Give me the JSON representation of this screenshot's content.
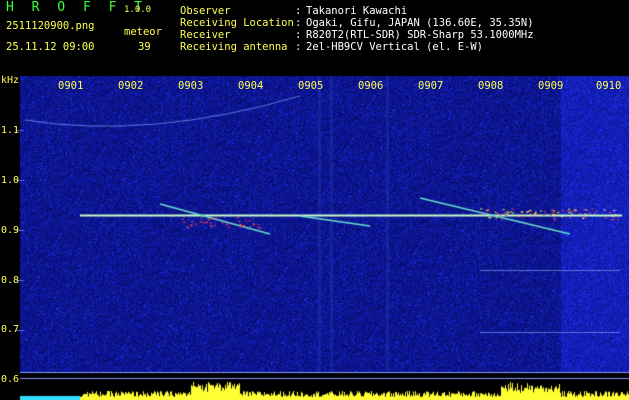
{
  "app": {
    "name": "H R O F F T",
    "version": "1.0.0"
  },
  "file": {
    "name": "2511120900.png",
    "datetime": "25.11.12 09:00"
  },
  "meteor": {
    "label": "meteor",
    "count": "39"
  },
  "info": [
    {
      "label": "Observer",
      "value": "Takanori Kawachi"
    },
    {
      "label": "Receiving Location",
      "value": "Ogaki, Gifu, JAPAN (136.60E, 35.35N)"
    },
    {
      "label": "Receiver",
      "value": "R820T2(RTL-SDR) SDR-Sharp 53.1000MHz"
    },
    {
      "label": "Receiving antenna",
      "value": "2el-HB9CV Vertical (el. E-W)"
    }
  ],
  "separator": ":",
  "axis": {
    "y_unit": "kHz",
    "y_ticks": [
      "1.1",
      "1.0",
      "0.9",
      "0.8",
      "0.7",
      "0.6"
    ],
    "time_ticks": [
      "0901",
      "0902",
      "0903",
      "0904",
      "0905",
      "0906",
      "0907",
      "0908",
      "0909",
      "0910"
    ]
  },
  "colors": {
    "background": "#000000",
    "spectrogram_base": "#0a1a8c",
    "title_green": "#3cff3c",
    "label_yellow": "#ffff55",
    "info_white": "#ffffff",
    "carrier_line": "#ccffcc",
    "power_bar": "#ffff33",
    "power_bar_cyan": "#33ddff"
  }
}
